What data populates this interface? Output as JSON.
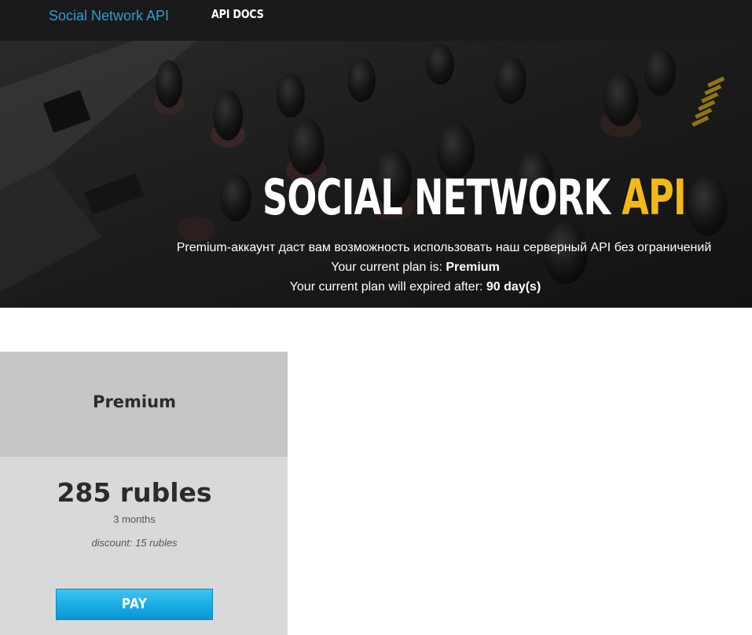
{
  "navbar": {
    "brand": "Social Network API",
    "links": [
      {
        "label": "API DOCS"
      }
    ]
  },
  "hero": {
    "title_main": "SOCIAL NETWORK ",
    "title_accent": "API",
    "accent_color": "#f5b915",
    "description": "Premium-аккаунт даст вам возможность использовать наш серверный API без ограничений",
    "current_plan_label": "Your current plan is: ",
    "current_plan_value": "Premium",
    "expire_label": "Your current plan will expired after: ",
    "expire_value": "90 day(s)"
  },
  "plans": [
    {
      "name": "Premium",
      "price": "285 rubles",
      "duration": "3 months",
      "discount": "discount: 15 rubles",
      "button_label": "PAY",
      "button_color": "#1aaee6"
    }
  ],
  "colors": {
    "brand": "#2a9fd6",
    "navbar_bg": "#1a1a1a",
    "card_bg": "#d9d9d9",
    "card_header_bg": "#c6c6c6"
  }
}
